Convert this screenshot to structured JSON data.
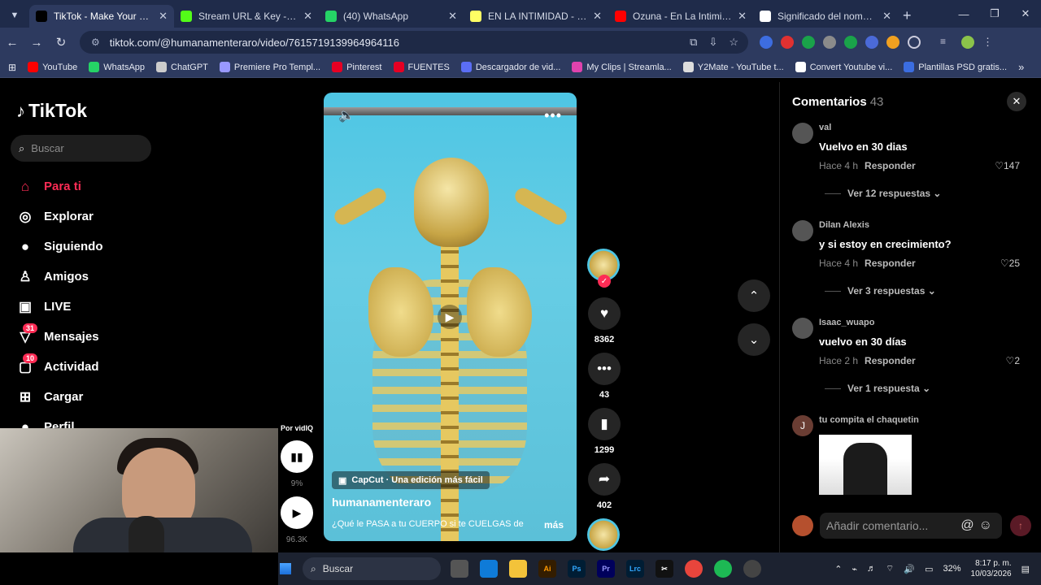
{
  "browser": {
    "tabs": [
      {
        "title": "TikTok - Make Your Day",
        "favicon": "tiktok-icon",
        "color": "#000000",
        "active": true
      },
      {
        "title": "Stream URL & Key - Kick D",
        "favicon": "kick-icon",
        "color": "#53fc18",
        "active": false
      },
      {
        "title": "(40) WhatsApp",
        "favicon": "whatsapp-icon",
        "color": "#25d366",
        "active": false
      },
      {
        "title": "EN LA INTIMIDAD - Ozuna",
        "favicon": "lyrics-icon",
        "color": "#ffff64",
        "active": false
      },
      {
        "title": "Ozuna - En La Intimidad (V",
        "favicon": "youtube-icon",
        "color": "#ff0000",
        "active": false
      },
      {
        "title": "Significado del nombre Gi",
        "favicon": "page-icon",
        "color": "#ffffff",
        "active": false
      }
    ],
    "new_tab": "+",
    "url": "tiktok.com/@humanamenteraro/video/7615719139964964116",
    "bookmarks": [
      {
        "label": "YouTube",
        "color": "#ff0000"
      },
      {
        "label": "WhatsApp",
        "color": "#25d366"
      },
      {
        "label": "ChatGPT",
        "color": "#cccccc"
      },
      {
        "label": "Premiere Pro Templ...",
        "color": "#9999ff"
      },
      {
        "label": "Pinterest",
        "color": "#e60023"
      },
      {
        "label": "FUENTES",
        "color": "#e60023"
      },
      {
        "label": "Descargador de vid...",
        "color": "#5b6ef5"
      },
      {
        "label": "My Clips | Streamla...",
        "color": "#e043ad"
      },
      {
        "label": "Y2Mate - YouTube t...",
        "color": "#dddddd"
      },
      {
        "label": "Convert Youtube vi...",
        "color": "#ffffff"
      },
      {
        "label": "Plantillas PSD gratis...",
        "color": "#3b6de0"
      }
    ]
  },
  "tiktok": {
    "logo": "TikTok",
    "search_placeholder": "Buscar",
    "nav": [
      {
        "label": "Para ti",
        "icon": "home-icon",
        "glyph": "⌂",
        "active": true
      },
      {
        "label": "Explorar",
        "icon": "compass-icon",
        "glyph": "◎",
        "active": false
      },
      {
        "label": "Siguiendo",
        "icon": "following-avatar-icon",
        "glyph": "●",
        "active": false
      },
      {
        "label": "Amigos",
        "icon": "friends-icon",
        "glyph": "♙",
        "active": false
      },
      {
        "label": "LIVE",
        "icon": "live-icon",
        "glyph": "▣",
        "active": false
      },
      {
        "label": "Mensajes",
        "icon": "messages-icon",
        "glyph": "▽",
        "badge": "31",
        "active": false
      },
      {
        "label": "Actividad",
        "icon": "activity-icon",
        "glyph": "▢",
        "badge": "10",
        "active": false
      },
      {
        "label": "Cargar",
        "icon": "upload-icon",
        "glyph": "⊞",
        "active": false
      },
      {
        "label": "Perfil",
        "icon": "profile-avatar-icon",
        "glyph": "●",
        "active": false
      }
    ],
    "video": {
      "capcut_label": "CapCut · Una edición más fácil",
      "author": "humanamenteraro",
      "description": "¿Qué le PASA a tu CUERPO si te CUELGAS de",
      "more_label": "más",
      "likes": "8362",
      "comments": "43",
      "saves": "1299",
      "shares": "402"
    },
    "vidiq": {
      "label": "Por vidIQ",
      "percent": "9%",
      "views": "96.3K"
    },
    "comments_panel": {
      "title": "Comentarios",
      "count": "43",
      "items": [
        {
          "user": "val",
          "text": "Vuelvo en 30 dias",
          "time": "Hace 4 h",
          "reply_label": "Responder",
          "likes": "147",
          "replies": "Ver 12 respuestas"
        },
        {
          "user": "Dilan Alexis",
          "text": "y si estoy en crecimiento?",
          "time": "Hace 4 h",
          "reply_label": "Responder",
          "likes": "25",
          "replies": "Ver 3 respuestas"
        },
        {
          "user": "Isaac_wuapo",
          "text": "vuelvo en 30 días",
          "time": "Hace 2 h",
          "reply_label": "Responder",
          "likes": "2",
          "replies": "Ver 1 respuesta"
        },
        {
          "user": "tu compita el chaquetin",
          "avatar_letter": "J"
        }
      ],
      "input_placeholder": "Añadir comentario..."
    }
  },
  "taskbar": {
    "search_placeholder": "Buscar",
    "battery": "32%",
    "time": "8:17 p. m.",
    "date": "10/03/2026"
  }
}
